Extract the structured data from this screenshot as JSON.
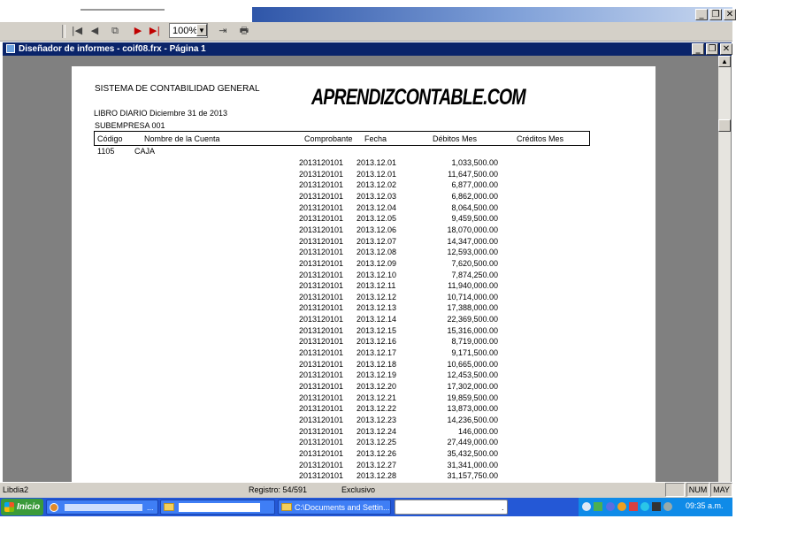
{
  "toolbar": {
    "zoom_value": "100%"
  },
  "report_window": {
    "title": "Diseñador de informes - coif08.frx - Página 1"
  },
  "report": {
    "system_title": "SISTEMA DE CONTABILIDAD GENERAL",
    "watermark": "APRENDIZCONTABLE.COM",
    "subtitle": "LIBRO DIARIO Diciembre 31 de 2013",
    "company": "SUBEMPRESA 001",
    "columns": {
      "code": "Código",
      "account_name": "Nombre de la Cuenta",
      "voucher": "Comprobante",
      "date": "Fecha",
      "debits": "Débitos Mes",
      "credits": "Créditos Mes"
    },
    "account": {
      "code": "1105",
      "name": "CAJA"
    },
    "rows": [
      {
        "voucher": "2013120101",
        "date": "2013.12.01",
        "debit": "1,033,500.00"
      },
      {
        "voucher": "2013120101",
        "date": "2013.12.01",
        "debit": "11,647,500.00"
      },
      {
        "voucher": "2013120101",
        "date": "2013.12.02",
        "debit": "6,877,000.00"
      },
      {
        "voucher": "2013120101",
        "date": "2013.12.03",
        "debit": "6,862,000.00"
      },
      {
        "voucher": "2013120101",
        "date": "2013.12.04",
        "debit": "8,064,500.00"
      },
      {
        "voucher": "2013120101",
        "date": "2013.12.05",
        "debit": "9,459,500.00"
      },
      {
        "voucher": "2013120101",
        "date": "2013.12.06",
        "debit": "18,070,000.00"
      },
      {
        "voucher": "2013120101",
        "date": "2013.12.07",
        "debit": "14,347,000.00"
      },
      {
        "voucher": "2013120101",
        "date": "2013.12.08",
        "debit": "12,593,000.00"
      },
      {
        "voucher": "2013120101",
        "date": "2013.12.09",
        "debit": "7,620,500.00"
      },
      {
        "voucher": "2013120101",
        "date": "2013.12.10",
        "debit": "7,874,250.00"
      },
      {
        "voucher": "2013120101",
        "date": "2013.12.11",
        "debit": "11,940,000.00"
      },
      {
        "voucher": "2013120101",
        "date": "2013.12.12",
        "debit": "10,714,000.00"
      },
      {
        "voucher": "2013120101",
        "date": "2013.12.13",
        "debit": "17,388,000.00"
      },
      {
        "voucher": "2013120101",
        "date": "2013.12.14",
        "debit": "22,369,500.00"
      },
      {
        "voucher": "2013120101",
        "date": "2013.12.15",
        "debit": "15,316,000.00"
      },
      {
        "voucher": "2013120101",
        "date": "2013.12.16",
        "debit": "8,719,000.00"
      },
      {
        "voucher": "2013120101",
        "date": "2013.12.17",
        "debit": "9,171,500.00"
      },
      {
        "voucher": "2013120101",
        "date": "2013.12.18",
        "debit": "10,665,000.00"
      },
      {
        "voucher": "2013120101",
        "date": "2013.12.19",
        "debit": "12,453,500.00"
      },
      {
        "voucher": "2013120101",
        "date": "2013.12.20",
        "debit": "17,302,000.00"
      },
      {
        "voucher": "2013120101",
        "date": "2013.12.21",
        "debit": "19,859,500.00"
      },
      {
        "voucher": "2013120101",
        "date": "2013.12.22",
        "debit": "13,873,000.00"
      },
      {
        "voucher": "2013120101",
        "date": "2013.12.23",
        "debit": "14,236,500.00"
      },
      {
        "voucher": "2013120101",
        "date": "2013.12.24",
        "debit": "146,000.00"
      },
      {
        "voucher": "2013120101",
        "date": "2013.12.25",
        "debit": "27,449,000.00"
      },
      {
        "voucher": "2013120101",
        "date": "2013.12.26",
        "debit": "35,432,500.00"
      },
      {
        "voucher": "2013120101",
        "date": "2013.12.27",
        "debit": "31,341,000.00"
      },
      {
        "voucher": "2013120101",
        "date": "2013.12.28",
        "debit": "31,157,750.00"
      }
    ]
  },
  "status_bar": {
    "table": "Libdia2",
    "record": "Registro: 54/591",
    "mode": "Exclusivo",
    "num": "NUM",
    "caps": "MAY"
  },
  "taskbar": {
    "start_label": "Inicio",
    "task_ellipsis": "...",
    "task_folder_label": "C:\\Documents and Settin...",
    "white_task_dot": ".",
    "clock": "09:35 a.m."
  },
  "icons": {
    "first": "first-page-icon",
    "prev": "previous-page-icon",
    "copy": "copy-icon",
    "next": "next-page-icon",
    "last": "last-page-icon",
    "close_preview": "close-preview-icon",
    "print": "print-icon"
  },
  "colors": {
    "title_bar": "#0a246a",
    "taskbar": "#2458d6",
    "start_button": "#3a9a3a",
    "tray": "#0f8be8"
  }
}
